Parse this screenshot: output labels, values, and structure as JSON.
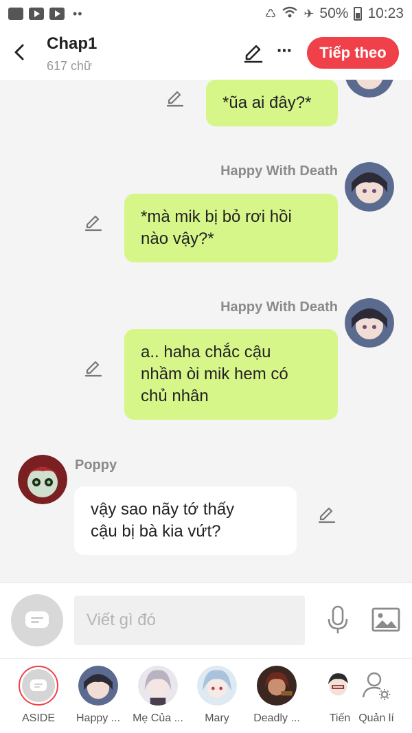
{
  "status_bar": {
    "battery": "50%",
    "time": "10:23"
  },
  "header": {
    "title": "Chap1",
    "subtitle": "617 chữ",
    "next_label": "Tiếp theo"
  },
  "messages": [
    {
      "sender": "",
      "text_lines": [
        "*ũa ai đây?*"
      ]
    },
    {
      "sender": "Happy With Death",
      "text_lines": [
        "*mà mik bị bỏ rơi hồi",
        "nào vậy?*"
      ]
    },
    {
      "sender": "Happy With Death",
      "text_lines": [
        "a.. haha chắc cậu",
        "nhầm òi mik hem có",
        "chủ nhân"
      ]
    },
    {
      "sender": "Poppy",
      "text_lines": [
        "vậy sao nãy tớ thấy",
        "cậu bị bà kia vứt?"
      ]
    }
  ],
  "input": {
    "placeholder": "Viết gì đó"
  },
  "characters": [
    {
      "label": "ASIDE"
    },
    {
      "label": "Happy ..."
    },
    {
      "label": "Mẹ Của ..."
    },
    {
      "label": "Mary"
    },
    {
      "label": "Deadly ..."
    },
    {
      "label": "Tiến"
    },
    {
      "label": "Quản lí"
    }
  ],
  "colors": {
    "accent": "#f0404a",
    "own_bubble": "#d7f68a",
    "other_bubble": "#ffffff",
    "background": "#f4f4f4"
  }
}
